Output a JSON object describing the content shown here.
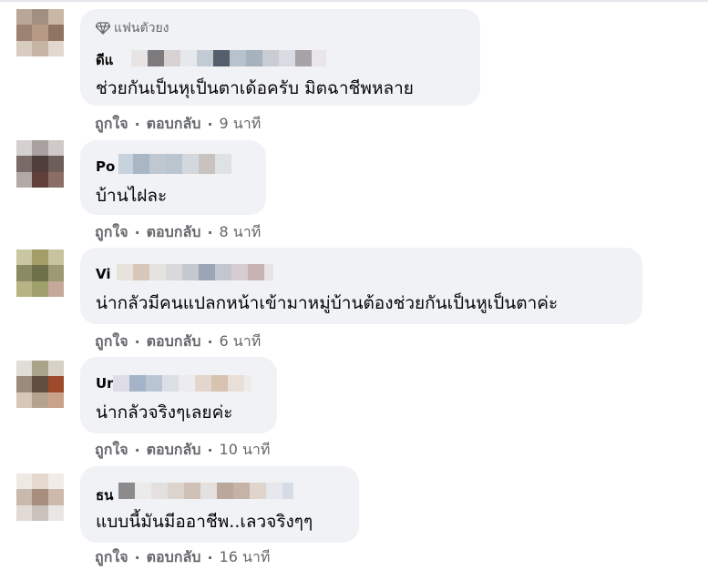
{
  "badge_label": "แฟนตัวยง",
  "actions": {
    "like": "ถูกใจ",
    "reply": "ตอบกลับ",
    "separator": "·"
  },
  "comments": [
    {
      "name": "ดีแ",
      "text": "ช่วยกันเป็นหุเป็นตาเด้อครับ มิตฉาชีพหลาย",
      "time": "9 นาที",
      "badge": true
    },
    {
      "name": "Po",
      "text": "บ้านไฝละ",
      "time": "8 นาที"
    },
    {
      "name": "Vi",
      "text": "น่ากลัวมีคนแปลกหน้าเข้ามาหมู่บ้านต้องช่วยกันเป็นหูเป็นตาค่ะ",
      "time": "6 นาที"
    },
    {
      "name": "Ur",
      "text": "น่ากลัวจริงๆเลยค่ะ",
      "time": "10 นาที"
    },
    {
      "name": "ธน",
      "text": "แบบนี้มันมีออาชีพ..เลวจริงๆๆ",
      "time": "16 นาที"
    }
  ],
  "colors": {
    "bubble": "#f0f2f5",
    "secondary_text": "#65676b",
    "primary_text": "#050505"
  },
  "icons": {
    "badge": "diamond-icon"
  }
}
